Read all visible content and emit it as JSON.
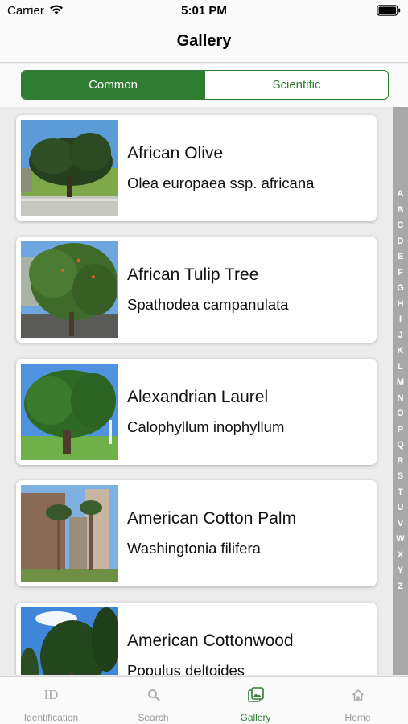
{
  "status": {
    "carrier": "Carrier",
    "time": "5:01 PM"
  },
  "nav": {
    "title": "Gallery"
  },
  "segments": [
    {
      "label": "Common",
      "selected": true
    },
    {
      "label": "Scientific",
      "selected": false
    }
  ],
  "items": [
    {
      "common": "African Olive",
      "scientific": "Olea europaea ssp. africana"
    },
    {
      "common": "African Tulip Tree",
      "scientific": "Spathodea campanulata"
    },
    {
      "common": "Alexandrian Laurel",
      "scientific": "Calophyllum inophyllum"
    },
    {
      "common": "American Cotton Palm",
      "scientific": "Washingtonia filifera"
    },
    {
      "common": "American Cottonwood",
      "scientific": "Populus deltoides"
    }
  ],
  "index_letters": [
    "A",
    "B",
    "C",
    "D",
    "E",
    "F",
    "G",
    "H",
    "I",
    "J",
    "K",
    "L",
    "M",
    "N",
    "O",
    "P",
    "Q",
    "R",
    "S",
    "T",
    "U",
    "V",
    "W",
    "X",
    "Y",
    "Z"
  ],
  "tabs": [
    {
      "label": "Identification",
      "icon": "id-icon",
      "id_glyph": "ID",
      "active": false
    },
    {
      "label": "Search",
      "icon": "search-icon",
      "active": false
    },
    {
      "label": "Gallery",
      "icon": "gallery-icon",
      "active": true
    },
    {
      "label": "Home",
      "icon": "home-icon",
      "active": false
    }
  ],
  "colors": {
    "accent": "#2e7d32",
    "index_bar": "#a8a8a8",
    "background": "#ececec"
  }
}
